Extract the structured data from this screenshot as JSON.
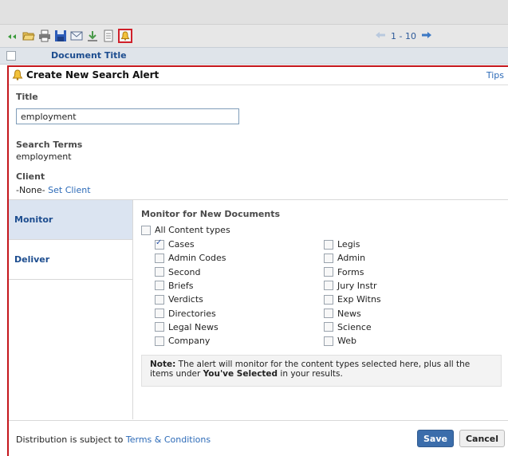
{
  "toolbar": {
    "pager": "1 - 10"
  },
  "column_header": {
    "document_title": "Document Title"
  },
  "panel": {
    "title": "Create New Search Alert",
    "tips": "Tips",
    "title_label": "Title",
    "title_value": "employment",
    "search_terms_label": "Search Terms",
    "search_terms_value": "employment",
    "client_label": "Client",
    "client_value": "-None-",
    "set_client": "Set Client"
  },
  "sidebar": {
    "items": [
      {
        "label": "Monitor",
        "active": true
      },
      {
        "label": "Deliver",
        "active": false
      }
    ]
  },
  "monitor": {
    "heading": "Monitor for New Documents",
    "all_label": "All Content types",
    "left": [
      {
        "label": "Cases",
        "checked": true
      },
      {
        "label": "Admin Codes",
        "checked": false
      },
      {
        "label": "Second",
        "checked": false
      },
      {
        "label": "Briefs",
        "checked": false
      },
      {
        "label": "Verdicts",
        "checked": false
      },
      {
        "label": "Directories",
        "checked": false
      },
      {
        "label": "Legal News",
        "checked": false
      },
      {
        "label": "Company",
        "checked": false
      }
    ],
    "right": [
      {
        "label": "Legis",
        "checked": false
      },
      {
        "label": "Admin",
        "checked": false
      },
      {
        "label": "Forms",
        "checked": false
      },
      {
        "label": "Jury Instr",
        "checked": false
      },
      {
        "label": "Exp Witns",
        "checked": false
      },
      {
        "label": "News",
        "checked": false
      },
      {
        "label": "Science",
        "checked": false
      },
      {
        "label": "Web",
        "checked": false
      }
    ],
    "note_bold": "Note:",
    "note_text": " The alert will monitor for the content types selected here, plus all the items under ",
    "note_bold2": "You've Selected",
    "note_text2": " in your results."
  },
  "footer": {
    "text": "Distribution is subject to ",
    "link": "Terms & Conditions",
    "save": "Save",
    "cancel": "Cancel"
  },
  "colors": {
    "accent": "#c4161c",
    "link": "#2d6bb8",
    "save_bg": "#3b6dab"
  }
}
